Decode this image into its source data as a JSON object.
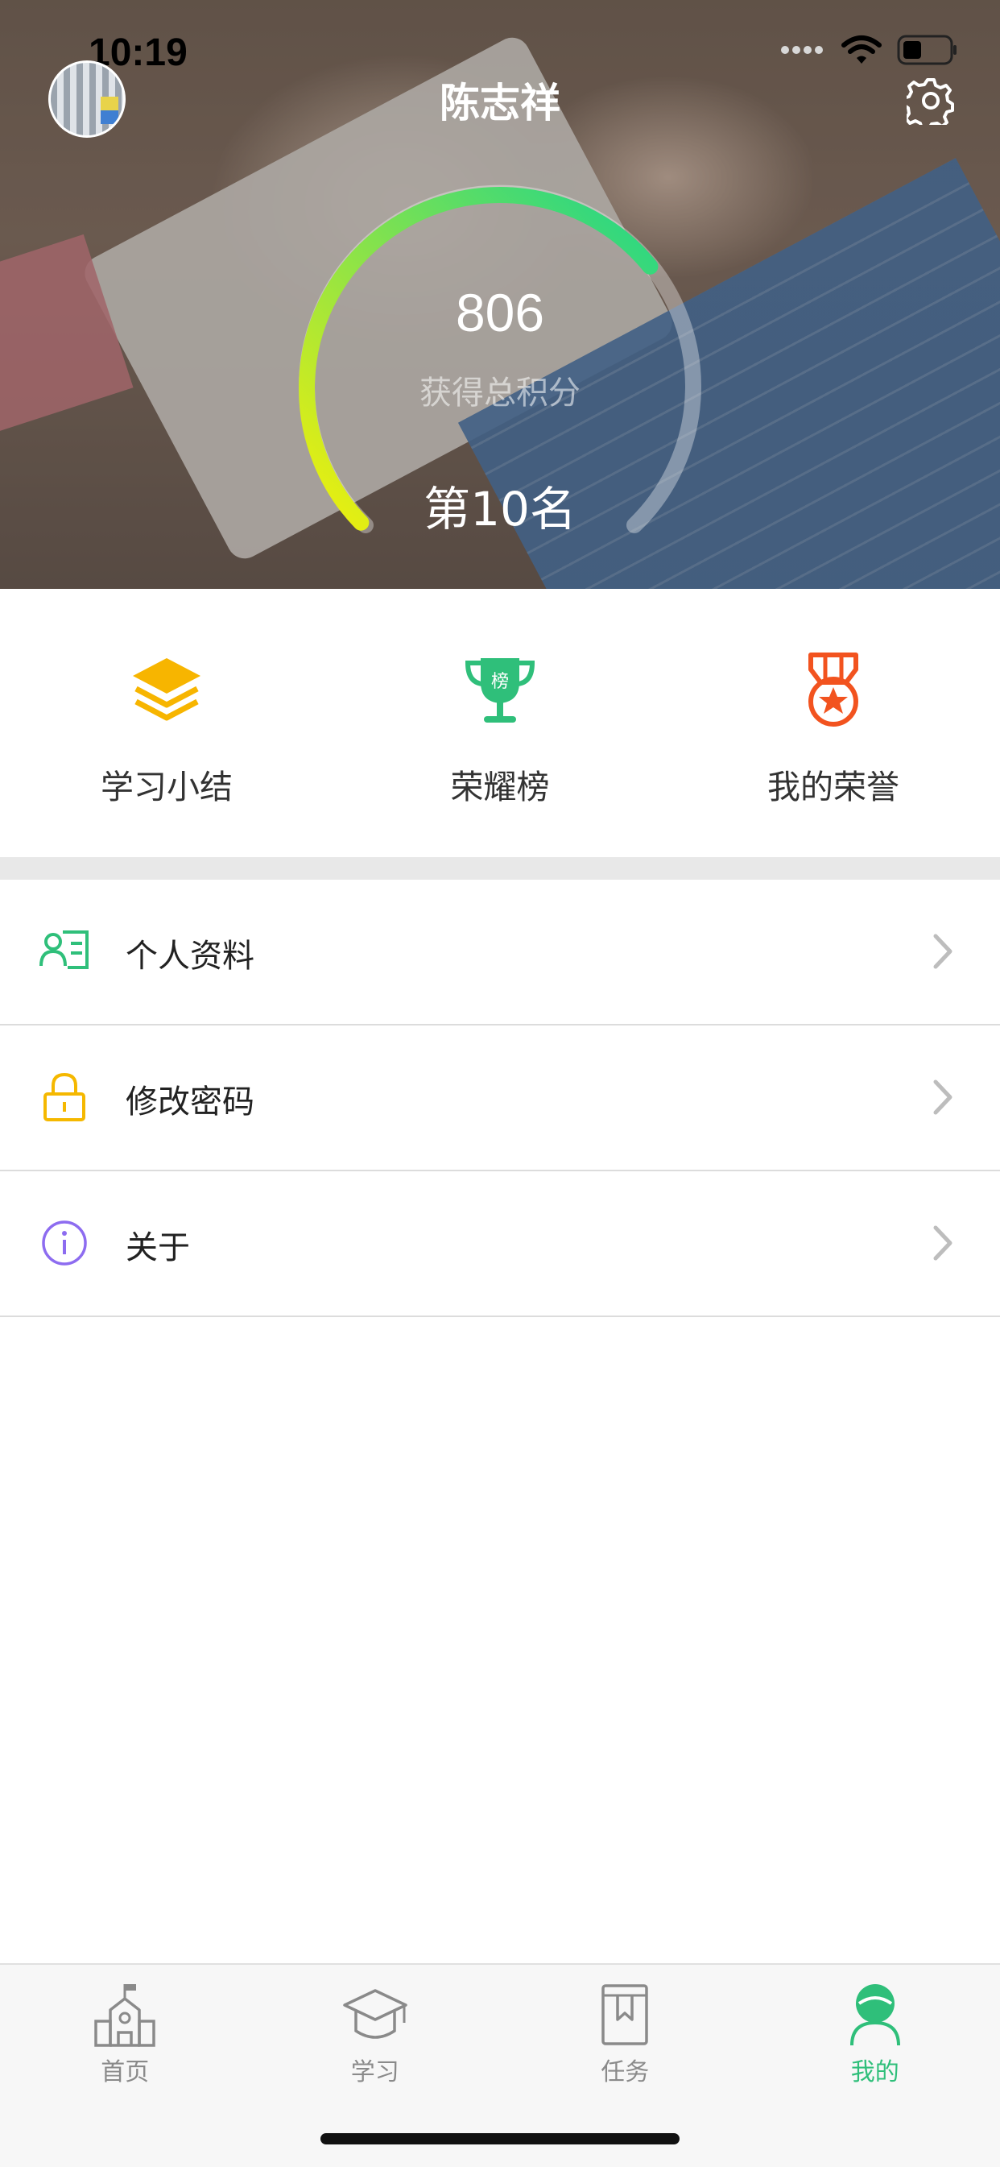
{
  "status_bar": {
    "time": "10:19"
  },
  "header": {
    "user_name": "陈志祥"
  },
  "stats": {
    "score": "806",
    "score_label": "获得总积分",
    "rank": "第10名",
    "progress_fraction": 0.68
  },
  "quick_links": [
    {
      "label": "学习小结",
      "icon": "layers-icon"
    },
    {
      "label": "荣耀榜",
      "icon": "trophy-icon",
      "badge": "榜"
    },
    {
      "label": "我的荣誉",
      "icon": "medal-icon"
    }
  ],
  "menu": [
    {
      "label": "个人资料",
      "icon": "profile-card-icon"
    },
    {
      "label": "修改密码",
      "icon": "lock-icon"
    },
    {
      "label": "关于",
      "icon": "info-icon"
    }
  ],
  "tabbar": [
    {
      "label": "首页",
      "icon": "school-icon",
      "active": false
    },
    {
      "label": "学习",
      "icon": "graduation-cap-icon",
      "active": false
    },
    {
      "label": "任务",
      "icon": "bookmark-book-icon",
      "active": false
    },
    {
      "label": "我的",
      "icon": "user-icon",
      "active": true
    }
  ],
  "colors": {
    "accent_green": "#2fbf7a",
    "gauge_start": "#f2f00a",
    "gauge_end": "#1fd58a",
    "layers_yellow": "#f7b500",
    "medal_red": "#f2531f",
    "lock_yellow": "#f5b800",
    "info_purple": "#8d6cf0"
  }
}
